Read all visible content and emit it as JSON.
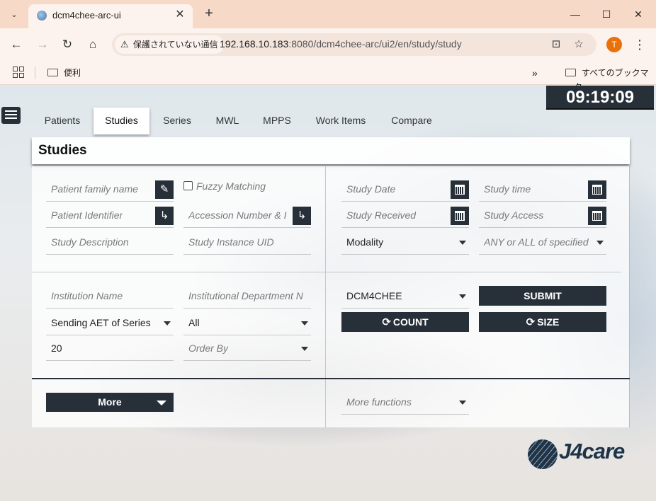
{
  "browser": {
    "tab_title": "dcm4chee-arc-ui",
    "security_label": "保護されていない通信",
    "url_host": "192.168.10.183",
    "url_rest": ":8080/dcm4chee-arc/ui2/en/study/study",
    "bookmark_folder": "便利",
    "all_bookmarks": "すべてのブックマーク",
    "profile_initial": "T",
    "new_tab": "+",
    "close_tab": "✕"
  },
  "clock": "09:19:09",
  "tabs": [
    "Patients",
    "Studies",
    "Series",
    "MWL",
    "MPPS",
    "Work Items",
    "Compare"
  ],
  "active_tab": "Studies",
  "page_title": "Studies",
  "filters": {
    "patient_family_name": "Patient family name",
    "fuzzy_matching": "Fuzzy Matching",
    "patient_identifier": "Patient Identifier",
    "accession_number": "Accession Number & I",
    "study_description": "Study Description",
    "study_instance_uid": "Study Instance UID",
    "study_date": "Study Date",
    "study_time": "Study time",
    "study_received": "Study Received",
    "study_access": "Study Access",
    "modality": "Modality",
    "any_or_all": "ANY or ALL of specified",
    "institution_name": "Institution Name",
    "institutional_department": "Institutional Department N",
    "sending_aet": "Sending AET of Series",
    "sending_aet_value": "All",
    "limit": "20",
    "order_by": "Order By",
    "aet": "DCM4CHEE"
  },
  "buttons": {
    "submit": "SUBMIT",
    "count": "COUNT",
    "size": "SIZE",
    "more": "More",
    "more_functions": "More functions"
  },
  "logo": "J4care"
}
